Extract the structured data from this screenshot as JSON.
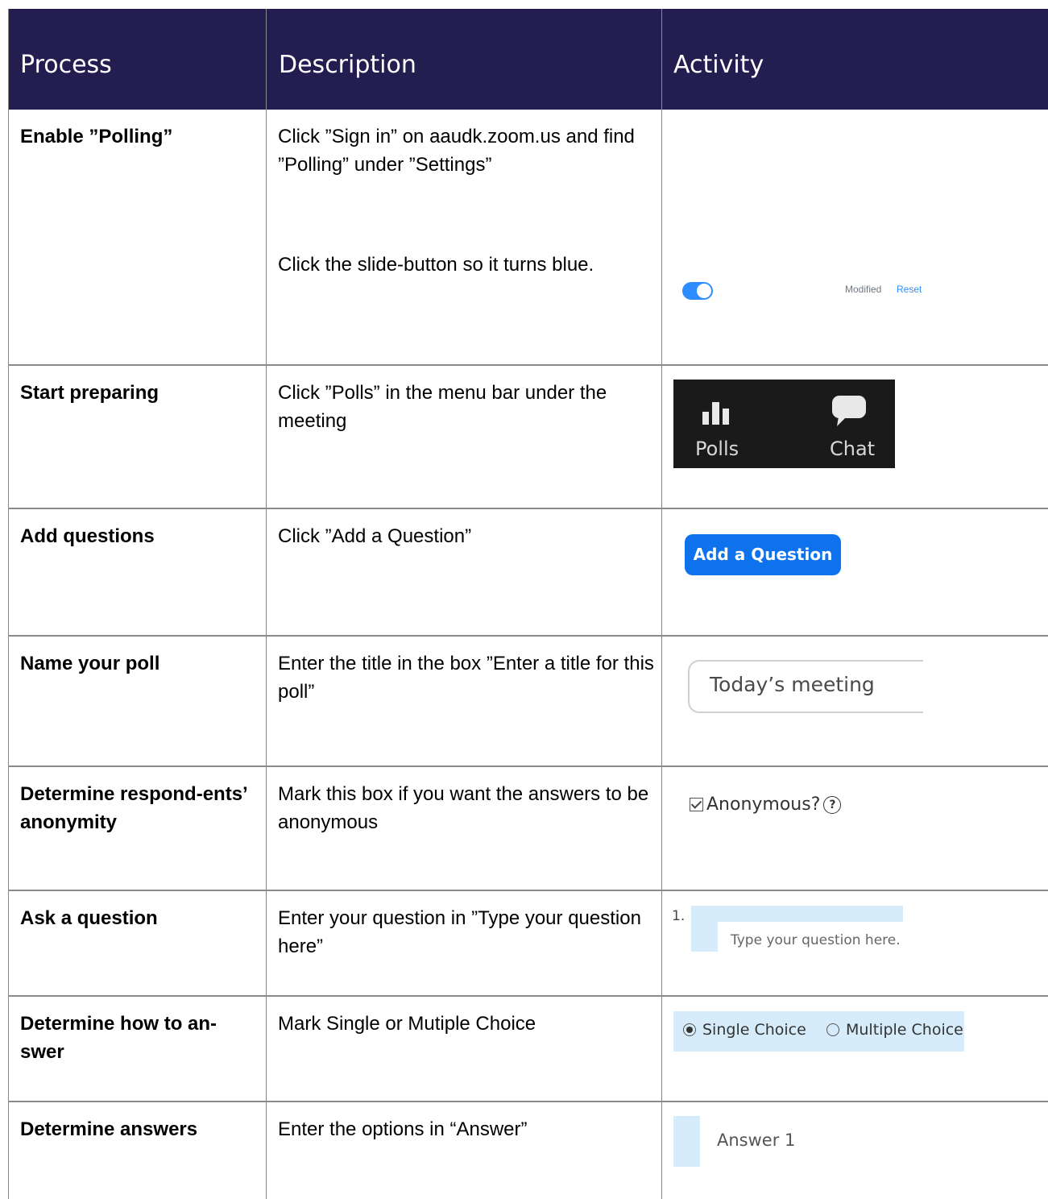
{
  "header": {
    "process": "Process",
    "description": "Description",
    "activity": "Activity"
  },
  "rows": [
    {
      "process": "Enable ”Polling”",
      "description": "Click ”Sign in” on aaudk.zoom.us and find ”Polling” under ”Settings”",
      "description2": "Click the slide-button so it turns blue.",
      "activity": {
        "modified": "Modified",
        "reset": "Reset"
      }
    },
    {
      "process": "Start preparing",
      "description": "Click ”Polls” in the menu bar under the meeting",
      "activity": {
        "polls": "Polls",
        "chat": "Chat"
      }
    },
    {
      "process": "Add questions",
      "description": "Click ”Add a Question”",
      "activity": {
        "button": "Add a Question"
      }
    },
    {
      "process": "Name your poll",
      "description": "Enter the title in the box ”Enter a title for this poll”",
      "activity": {
        "value": "Today’s meeting"
      }
    },
    {
      "process": "Determine respond-ents’ anonymity",
      "description": "Mark this box if you want the answers to be anonymous",
      "activity": {
        "label": "Anonymous?",
        "checked": true
      }
    },
    {
      "process": "Ask a question",
      "description": "Enter your question in ”Type your question here”",
      "activity": {
        "number": "1.",
        "placeholder": "Type your question here."
      }
    },
    {
      "process": "Determine how to an-swer",
      "description": "Mark Single or Mutiple Choice",
      "activity": {
        "single": "Single Choice",
        "multiple": "Multiple Choice",
        "selected": "single"
      }
    },
    {
      "process": "Determine answers",
      "description": "Enter the options in “Answer”",
      "activity": {
        "label": "Answer 1"
      }
    }
  ],
  "colors": {
    "header_bg": "#231e4f",
    "zoom_blue": "#2d8cff",
    "button_blue": "#0e72ed",
    "light_blue": "#d7ecfb"
  }
}
